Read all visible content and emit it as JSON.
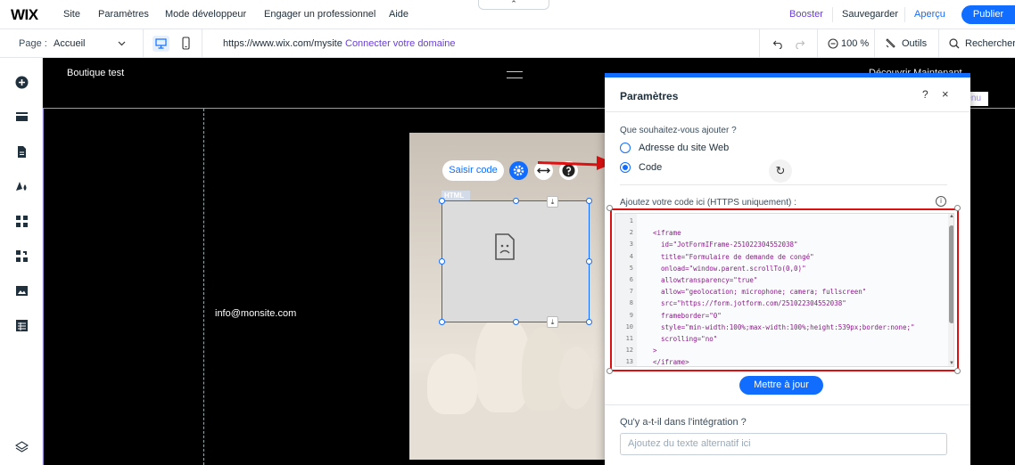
{
  "topbar": {
    "logo": "WIX",
    "menu": [
      "Site",
      "Paramètres",
      "Mode développeur",
      "Engager un professionnel",
      "Aide"
    ],
    "collapse_glyph": "⌃",
    "boost": "Booster",
    "save": "Sauvegarder",
    "preview": "Aperçu",
    "publish": "Publier",
    "accent": "#116dff"
  },
  "bar2": {
    "page_label": "Page :",
    "page_value": "Accueil",
    "url": "https://www.wix.com/mysite",
    "connect_domain": "Connecter votre domaine",
    "zoom": "100 %",
    "tools": "Outils",
    "search": "Rechercher"
  },
  "canvas": {
    "site_title": "Boutique test",
    "top_right": "Découvrir Maintenant",
    "menu_label": "Menu",
    "email": "info@monsite.com",
    "html_tag": "HTML",
    "edit_code": "Saisir code"
  },
  "dialog": {
    "title": "Paramètres",
    "help": "?",
    "close": "×",
    "question": "Que souhaitez-vous ajouter ?",
    "option_web": "Adresse du site Web",
    "option_code": "Code",
    "selected": "Code",
    "code_label": "Ajoutez votre code ici (HTTPS uniquement) :",
    "code_lines": [
      {
        "n": "1",
        "text": ""
      },
      {
        "n": "2",
        "text": "<iframe"
      },
      {
        "n": "3",
        "text": "  id=\"JotFormIFrame-251022304552038\""
      },
      {
        "n": "4",
        "text": "  title=\"Formulaire de demande de congé\""
      },
      {
        "n": "5",
        "text": "  onload=\"window.parent.scrollTo(0,0)\""
      },
      {
        "n": "6",
        "text": "  allowtransparency=\"true\""
      },
      {
        "n": "7",
        "text": "  allow=\"geolocation; microphone; camera; fullscreen\""
      },
      {
        "n": "8",
        "text": "  src=\"https://form.jotform.com/251022304552038\""
      },
      {
        "n": "9",
        "text": "  frameborder=\"0\""
      },
      {
        "n": "10",
        "text": "  style=\"min-width:100%;max-width:100%;height:539px;border:none;\""
      },
      {
        "n": "11",
        "text": "  scrolling=\"no\""
      },
      {
        "n": "12",
        "text": ">"
      },
      {
        "n": "13",
        "text": "</iframe>"
      }
    ],
    "update_button": "Mettre à jour",
    "alt_question": "Qu'y a-t-il dans l'intégration ?",
    "alt_placeholder": "Ajoutez du texte alternatif ici"
  },
  "icons": [
    "add-icon",
    "pages-icon",
    "page-icon",
    "design-icon",
    "apps-icon",
    "business-icon",
    "media-icon",
    "cms-icon",
    "layers-icon",
    "desktop-icon",
    "mobile-icon",
    "undo-icon",
    "redo-icon",
    "zoom-icon",
    "tools-icon",
    "search-icon",
    "gear-icon",
    "stretch-icon",
    "help-icon",
    "broken-file-icon",
    "download-icon",
    "info-icon",
    "chevron-down-icon"
  ]
}
